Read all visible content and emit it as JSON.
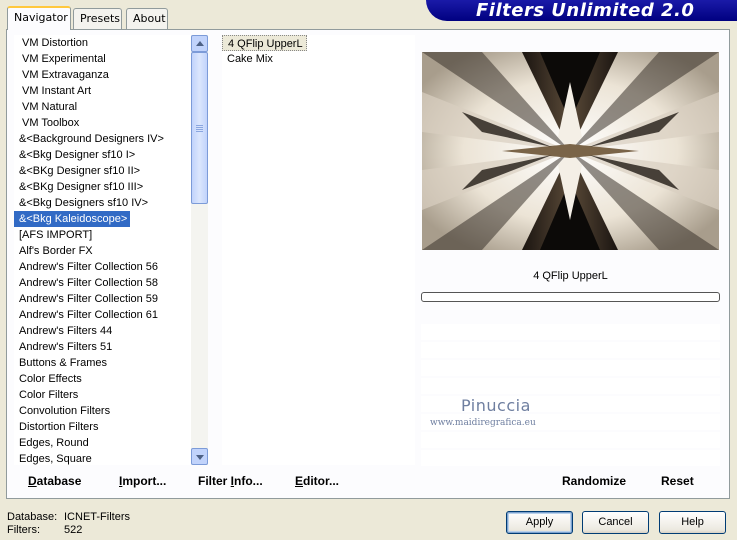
{
  "tabs": [
    {
      "label": "Navigator"
    },
    {
      "label": "Presets"
    },
    {
      "label": "About"
    }
  ],
  "banner_title": "Filters Unlimited 2.0",
  "categories": [
    "VM Distortion",
    "VM Experimental",
    "VM Extravaganza",
    "VM Instant Art",
    "VM Natural",
    "VM Toolbox",
    "&<Background Designers IV>",
    "&<Bkg Designer sf10 I>",
    "&<BKg Designer sf10 II>",
    "&<BKg Designer sf10 III>",
    "&<Bkg Designers sf10 IV>",
    "&<Bkg Kaleidoscope>",
    "[AFS IMPORT]",
    "Alf's Border FX",
    "Andrew's Filter Collection 56",
    "Andrew's Filter Collection 58",
    "Andrew's Filter Collection 59",
    "Andrew's Filter Collection 61",
    "Andrew's Filters 44",
    "Andrew's Filters 51",
    "Buttons & Frames",
    "Color Effects",
    "Color Filters",
    "Convolution Filters",
    "Distortion Filters",
    "Edges, Round",
    "Edges, Square"
  ],
  "selected_category": "&<Bkg Kaleidoscope>",
  "filters": [
    "4 QFlip UpperL",
    "Cake Mix"
  ],
  "selected_filter": "4 QFlip UpperL",
  "filter_title": "4 QFlip UpperL",
  "buttons": {
    "database": "Database",
    "import": "Import...",
    "filter_info": "Filter Info...",
    "editor": "Editor...",
    "randomize": "Randomize",
    "reset": "Reset",
    "apply": "Apply",
    "cancel": "Cancel",
    "help": "Help"
  },
  "info": {
    "database_label": "Database:",
    "database_value": "ICNET-Filters",
    "filters_label": "Filters:",
    "filters_value": "522"
  },
  "watermark": {
    "name": "Pinuccia",
    "url": "www.maidiregrafica.eu"
  }
}
